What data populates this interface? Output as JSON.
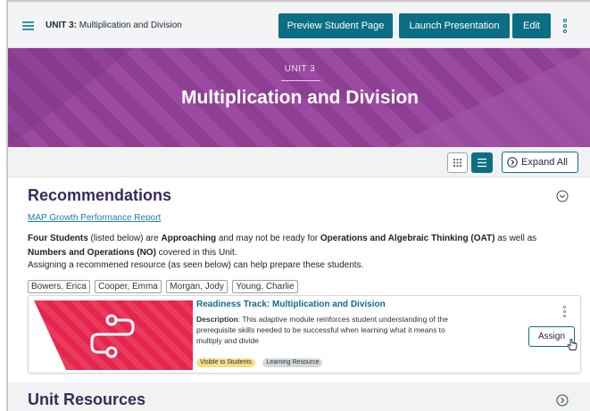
{
  "header": {
    "unit_prefix": "UNIT 3:",
    "unit_name": "Multiplication and Division",
    "preview_label": "Preview Student Page",
    "launch_label": "Launch Presentation",
    "edit_label": "Edit"
  },
  "banner": {
    "unit_label": "UNIT 3",
    "title": "Multiplication and Division",
    "color": "#8d3f92"
  },
  "view": {
    "expand_all_label": "Expand All"
  },
  "recommendations": {
    "title": "Recommendations",
    "report_link": "MAP Growth Performance Report",
    "text_students": "Four Students",
    "text_1": " (listed below) are ",
    "text_approaching": "Approaching",
    "text_2": " and may not be ready for ",
    "text_oat": "Operations and Algebraic Thinking (OAT)",
    "text_3": " as well as ",
    "text_no": "Numbers and Operations (NO)",
    "text_4": " covered in this Unit.",
    "assign_note": "Assigning a recommened resource (as seen below) can help prepare these students.",
    "students": [
      "Bowers, Erica",
      "Cooper, Emma",
      "Morgan, Jody",
      "Young, Charlie"
    ]
  },
  "resource": {
    "title": "Readiness Track: Multiplication and Division",
    "desc_label": "Description",
    "desc_text": ": This adaptive module reinforces student understanding of the prerequisite skills needed to be successful when learning what it means to multiply and divide",
    "tag_visible": "Visible to Students",
    "tag_type": "Learning Resource",
    "assign_label": "Assign",
    "thumb_color": "#e4254e"
  },
  "unit_resources": {
    "title": "Unit Resources"
  },
  "colors": {
    "primary": "#0c6e84",
    "heading": "#3a2a5d",
    "link": "#1a7fb0"
  }
}
